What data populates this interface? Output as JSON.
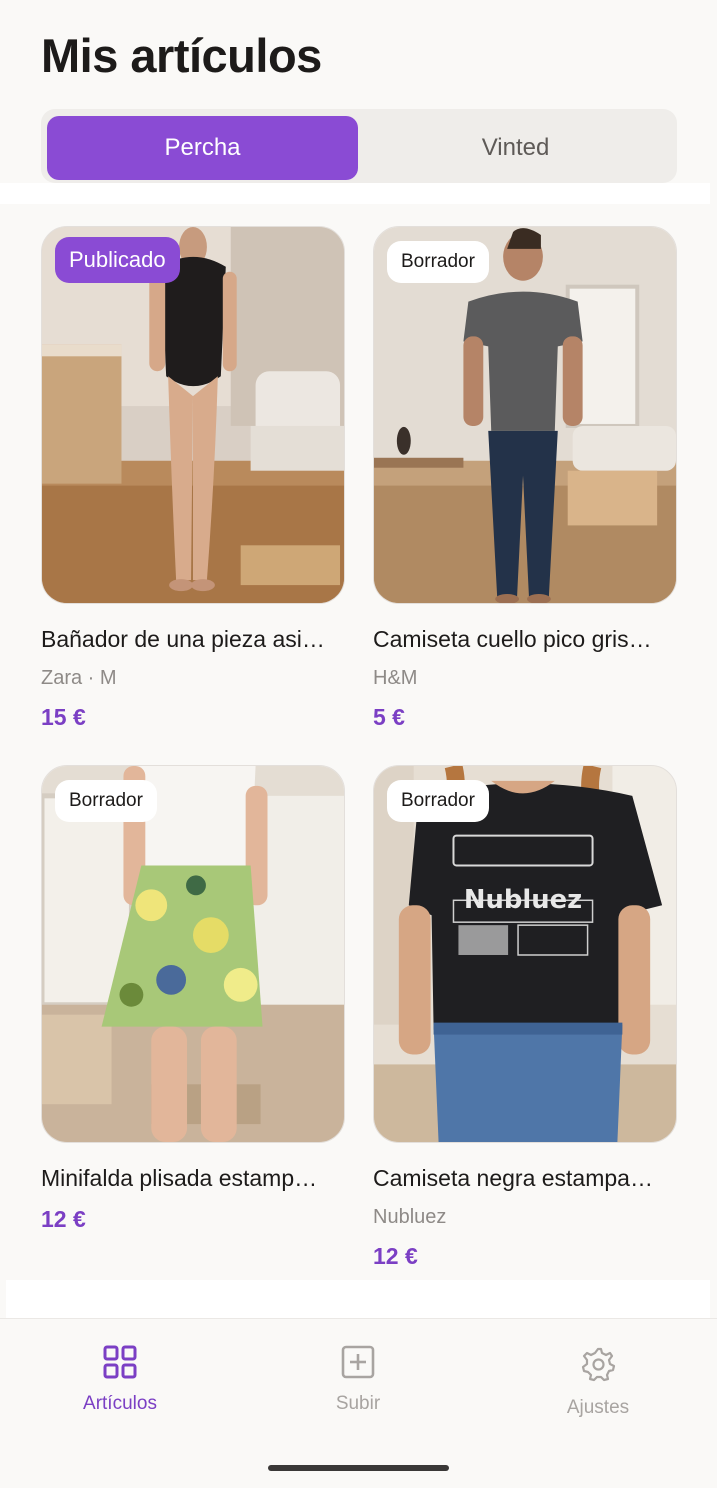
{
  "header": {
    "title": "Mis artículos"
  },
  "tabs": [
    {
      "label": "Percha",
      "active": true
    },
    {
      "label": "Vinted",
      "active": false
    }
  ],
  "items": [
    {
      "status": "Publicado",
      "title": "Bañador de una pieza asi…",
      "subtitle": "Zara · M",
      "price": "15 €"
    },
    {
      "status": "Borrador",
      "title": "Camiseta cuello pico gris…",
      "subtitle": "H&M",
      "price": "5 €"
    },
    {
      "status": "Borrador",
      "title": "Minifalda plisada estamp…",
      "subtitle": "",
      "price": "12 €"
    },
    {
      "status": "Borrador",
      "title": "Camiseta negra estampa…",
      "subtitle": "Nubluez",
      "price": "12 €"
    }
  ],
  "nav": [
    {
      "label": "Artículos",
      "icon": "grid-icon",
      "active": true
    },
    {
      "label": "Subir",
      "icon": "add-square-icon",
      "active": false
    },
    {
      "label": "Ajustes",
      "icon": "gear-icon",
      "active": false
    }
  ],
  "colors": {
    "accent": "#8a4bd4",
    "price": "#7b3fc4",
    "background": "#faf9f7"
  }
}
